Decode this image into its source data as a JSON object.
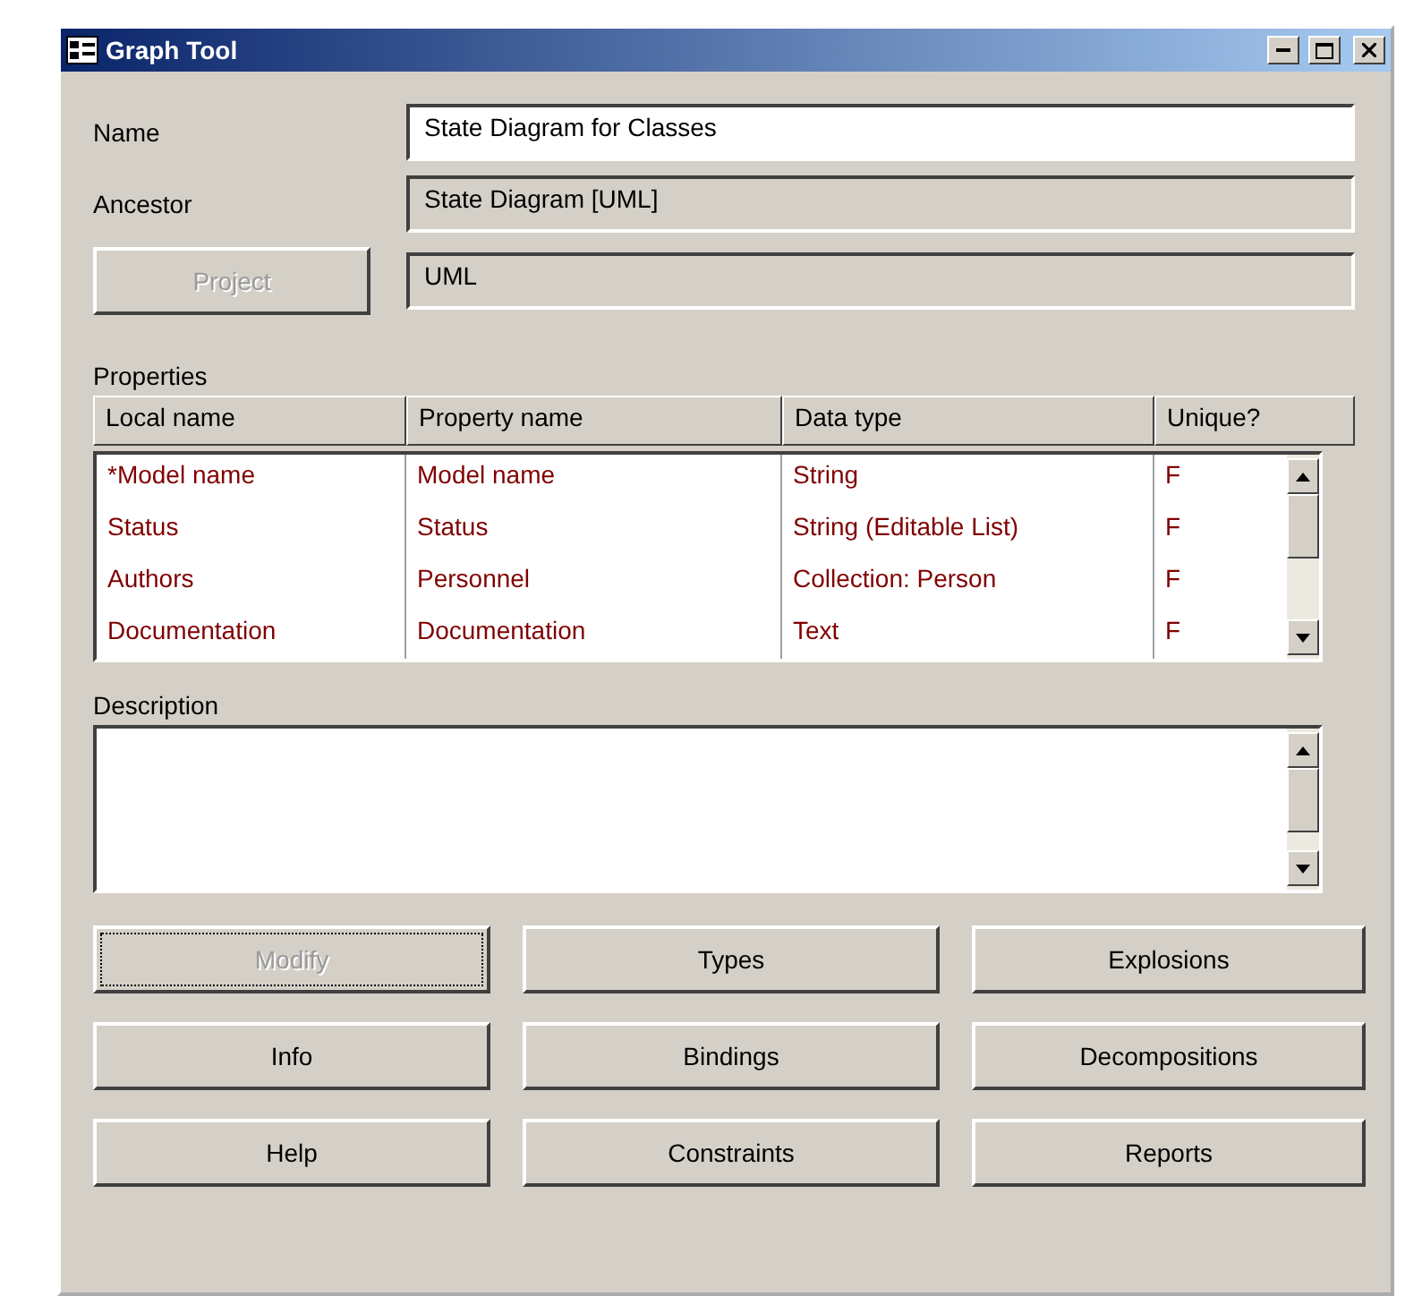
{
  "window": {
    "title": "Graph Tool"
  },
  "fields": [
    {
      "label": "Name",
      "value": "State Diagram for Classes",
      "editable": true
    },
    {
      "label": "Ancestor",
      "value": "State Diagram [UML]",
      "editable": false
    }
  ],
  "project": {
    "button": {
      "label": "Project",
      "disabled": true
    },
    "value": "UML",
    "editable": false
  },
  "properties": {
    "label": "Properties",
    "columns": [
      "Local name",
      "Property name",
      "Data type",
      "Unique?"
    ],
    "rows": [
      {
        "cells": [
          "*Model name",
          "Model name",
          "String",
          "F"
        ]
      },
      {
        "cells": [
          "Status",
          "Status",
          "String (Editable List)",
          "F"
        ]
      },
      {
        "cells": [
          "Authors",
          "Personnel",
          "Collection: Person",
          "F"
        ]
      },
      {
        "cells": [
          "Documentation",
          "Documentation",
          "Text",
          "F"
        ]
      }
    ]
  },
  "description": {
    "label": "Description"
  },
  "buttons": [
    {
      "label": "Modify",
      "disabled": true,
      "focused": true
    },
    {
      "label": "Types",
      "disabled": false,
      "focused": false
    },
    {
      "label": "Explosions",
      "disabled": false,
      "focused": false
    },
    {
      "label": "Info",
      "disabled": false,
      "focused": false
    },
    {
      "label": "Bindings",
      "disabled": false,
      "focused": false
    },
    {
      "label": "Decompositions",
      "disabled": false,
      "focused": false
    },
    {
      "label": "Help",
      "disabled": false,
      "focused": false
    },
    {
      "label": "Constraints",
      "disabled": false,
      "focused": false
    },
    {
      "label": "Reports",
      "disabled": false,
      "focused": false
    }
  ]
}
